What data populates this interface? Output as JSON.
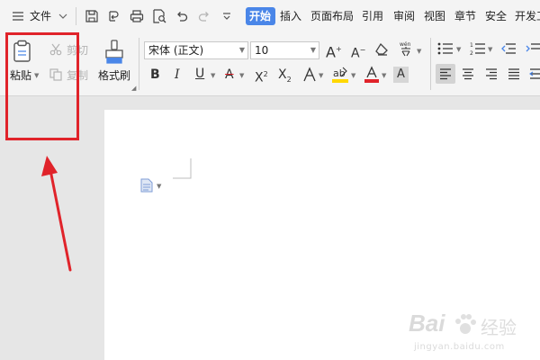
{
  "menu": {
    "file": "文件",
    "tabs": [
      {
        "label": "开始",
        "active": true
      },
      {
        "label": "插入"
      },
      {
        "label": "页面布局"
      },
      {
        "label": "引用"
      },
      {
        "label": "审阅"
      },
      {
        "label": "视图"
      },
      {
        "label": "章节"
      },
      {
        "label": "安全"
      },
      {
        "label": "开发工"
      }
    ]
  },
  "ribbon": {
    "paste_label": "粘贴",
    "cut_label": "剪切",
    "copy_label": "复制",
    "format_painter_label": "格式刷",
    "font_name": "宋体 (正文)",
    "font_size": "10"
  },
  "watermark": {
    "brand": "Bai",
    "brand_cn": "经验",
    "url": "jingyan.baidu.com"
  },
  "colors": {
    "accent": "#4a86e8",
    "highlight_yellow": "#ffd800",
    "font_red": "#e0232a",
    "annotation_red": "#e0232a"
  }
}
